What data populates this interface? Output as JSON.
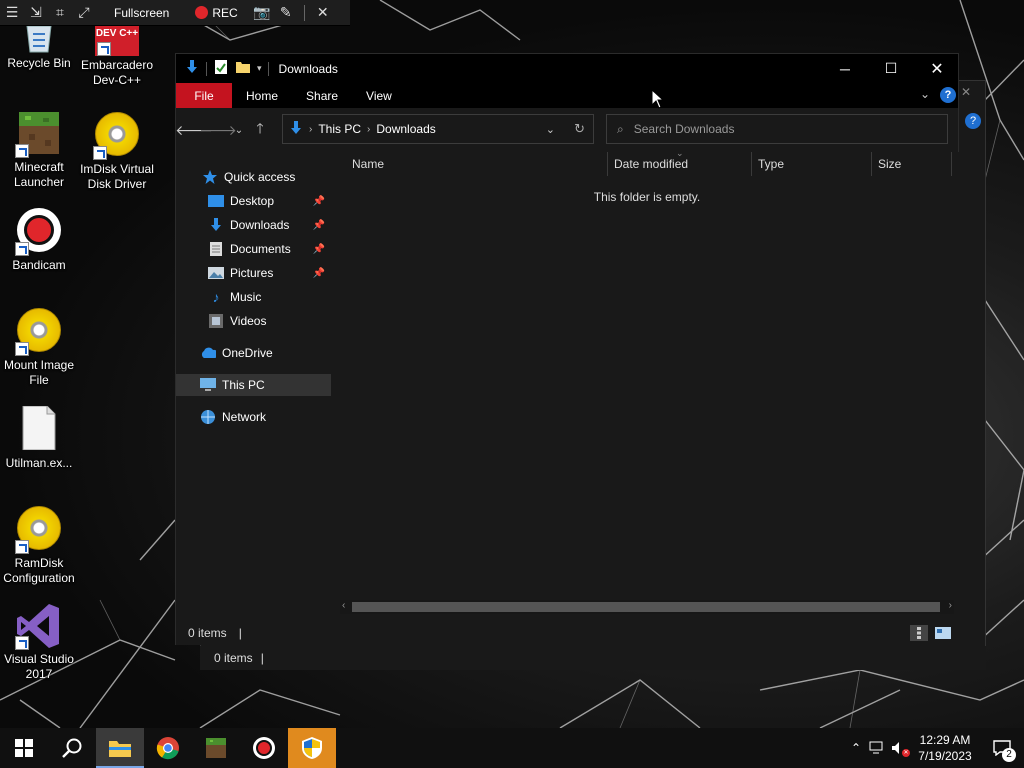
{
  "recorder": {
    "mode_label": "Fullscreen",
    "rec_label": "REC"
  },
  "desktop_icons": [
    {
      "label": "Recycle Bin"
    },
    {
      "label": "Embarcadero Dev-C++",
      "logo_text": "DEV C++"
    },
    {
      "label": "Minecraft Launcher"
    },
    {
      "label": "ImDisk Virtual Disk Driver"
    },
    {
      "label": "Bandicam"
    },
    {
      "label": "Mount Image File"
    },
    {
      "label": "Utilman.ex..."
    },
    {
      "label": "RamDisk Configuration"
    },
    {
      "label": "Visual Studio 2017"
    }
  ],
  "explorer": {
    "title": "Downloads",
    "ribbon_tabs": [
      "File",
      "Home",
      "Share",
      "View"
    ],
    "address": {
      "crumbs": [
        "This PC",
        "Downloads"
      ]
    },
    "search": {
      "placeholder": "Search Downloads"
    },
    "nav_items": [
      {
        "label": "Quick access",
        "icon": "star-icon"
      },
      {
        "label": "Desktop",
        "icon": "desktop-icon",
        "pinned": true
      },
      {
        "label": "Downloads",
        "icon": "download-arrow-icon",
        "pinned": true
      },
      {
        "label": "Documents",
        "icon": "document-icon",
        "pinned": true
      },
      {
        "label": "Pictures",
        "icon": "picture-icon",
        "pinned": true
      },
      {
        "label": "Music",
        "icon": "music-note-icon"
      },
      {
        "label": "Videos",
        "icon": "video-icon"
      },
      {
        "label": "OneDrive",
        "icon": "cloud-icon"
      },
      {
        "label": "This PC",
        "icon": "computer-icon",
        "selected": true
      },
      {
        "label": "Network",
        "icon": "network-icon"
      }
    ],
    "columns": [
      "Name",
      "Date modified",
      "Type",
      "Size"
    ],
    "empty_message": "This folder is empty.",
    "status": "0 items",
    "ghost_status": "0 items"
  },
  "taskbar": {
    "apps": [
      "file-explorer-icon",
      "chrome-icon",
      "minecraft-icon",
      "bandicam-icon",
      "security-shield-icon"
    ],
    "clock": {
      "time": "12:29 AM",
      "date": "7/19/2023"
    },
    "notifications_count": "2"
  },
  "colors": {
    "accent_file_tab": "#c4131f",
    "selection": "#333333",
    "window_bg": "#191919",
    "title_bg": "#000000"
  }
}
